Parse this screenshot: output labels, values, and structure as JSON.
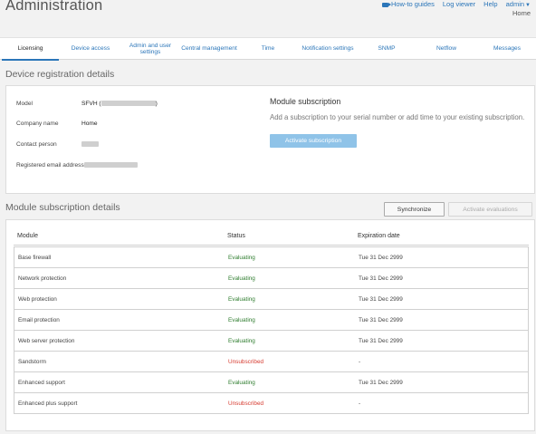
{
  "header": {
    "title": "Administration",
    "links": {
      "how_to": "How-to guides",
      "log_viewer": "Log viewer",
      "help": "Help",
      "user": "admin"
    },
    "sub_label": "Home"
  },
  "tabs": [
    {
      "label": "Licensing",
      "active": true
    },
    {
      "label": "Device access"
    },
    {
      "label": "Admin and user settings"
    },
    {
      "label": "Central management"
    },
    {
      "label": "Time"
    },
    {
      "label": "Notification settings"
    },
    {
      "label": "SNMP"
    },
    {
      "label": "Netflow"
    },
    {
      "label": "Messages"
    }
  ],
  "registration": {
    "section_title": "Device registration details",
    "model_label": "Model",
    "model_value_prefix": "SFVH (",
    "model_value_suffix": ")",
    "company_label": "Company name",
    "company_value": "Home",
    "contact_label": "Contact person",
    "email_label": "Registered email address"
  },
  "module_subscription": {
    "title": "Module subscription",
    "description": "Add a subscription to your serial number or add time to your existing subscription.",
    "activate_label": "Activate subscription"
  },
  "subscription_details": {
    "section_title": "Module subscription details",
    "sync_label": "Synchronize",
    "evaluations_label": "Activate evaluations",
    "columns": {
      "module": "Module",
      "status": "Status",
      "expiration": "Expiration date"
    },
    "rows": [
      {
        "module": "Base firewall",
        "status": "Evaluating",
        "expiration": "Tue 31 Dec 2999"
      },
      {
        "module": "Network protection",
        "status": "Evaluating",
        "expiration": "Tue 31 Dec 2999"
      },
      {
        "module": "Web protection",
        "status": "Evaluating",
        "expiration": "Tue 31 Dec 2999"
      },
      {
        "module": "Email protection",
        "status": "Evaluating",
        "expiration": "Tue 31 Dec 2999"
      },
      {
        "module": "Web server protection",
        "status": "Evaluating",
        "expiration": "Tue 31 Dec 2999"
      },
      {
        "module": "Sandstorm",
        "status": "Unsubscribed",
        "expiration": "-"
      },
      {
        "module": "Enhanced support",
        "status": "Evaluating",
        "expiration": "Tue 31 Dec 2999"
      },
      {
        "module": "Enhanced plus support",
        "status": "Unsubscribed",
        "expiration": "-"
      }
    ]
  },
  "colors": {
    "accent": "#2b76b9",
    "evaluating": "#2f7d2f",
    "unsubscribed": "#d63a2f",
    "activate_button": "#8fc3e8"
  }
}
